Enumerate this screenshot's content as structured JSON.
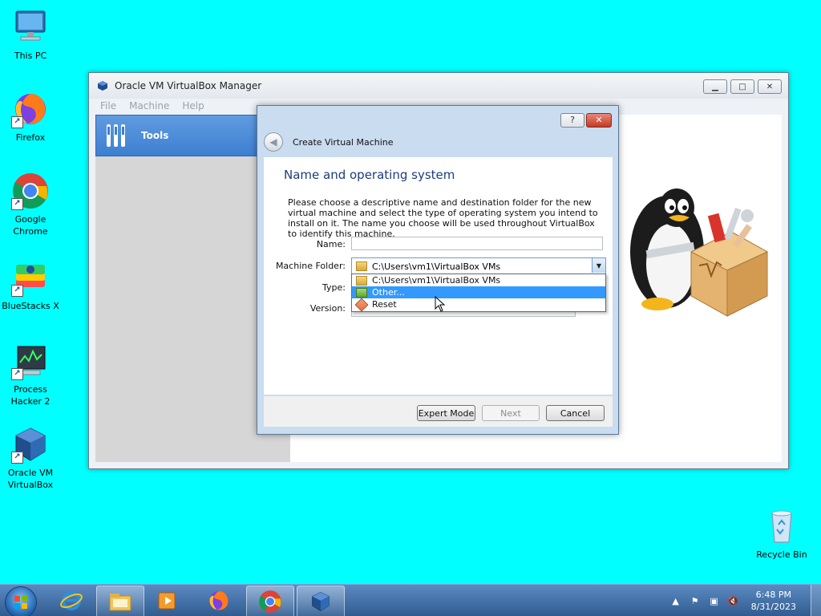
{
  "desktop": {
    "icons": [
      {
        "label": "This PC",
        "icon": "computer-icon"
      },
      {
        "label": "Firefox",
        "icon": "firefox-icon"
      },
      {
        "label": "Google Chrome",
        "icon": "chrome-icon"
      },
      {
        "label": "BlueStacks X",
        "icon": "bluestacks-icon"
      },
      {
        "label": "Process Hacker 2",
        "icon": "process-hacker-icon"
      },
      {
        "label": "Oracle VM VirtualBox",
        "icon": "virtualbox-icon"
      },
      {
        "label": "Recycle Bin",
        "icon": "recycle-bin-icon"
      }
    ]
  },
  "vbox": {
    "title": "Oracle VM VirtualBox Manager",
    "menu": [
      "File",
      "Machine",
      "Help"
    ],
    "tools_label": "Tools"
  },
  "dialog": {
    "title": "Create Virtual Machine",
    "heading": "Name and operating system",
    "description": "Please choose a descriptive name and destination folder for the new virtual machine and select the type of operating system you intend to install on it. The name you choose will be used throughout VirtualBox to identify this machine.",
    "name_label": "Name:",
    "name_value": "",
    "folder_label": "Machine Folder:",
    "folder_value": "C:\\Users\\vm1\\VirtualBox VMs",
    "type_label": "Type:",
    "version_label": "Version:",
    "dropdown": [
      {
        "label": "C:\\Users\\vm1\\VirtualBox VMs",
        "selected": false
      },
      {
        "label": "Other...",
        "selected": true
      },
      {
        "label": "Reset",
        "selected": false
      }
    ],
    "expert_label": "Expert Mode",
    "next_label": "Next",
    "cancel_label": "Cancel",
    "help_glyph": "?"
  },
  "taskbar": {
    "items": [
      "start",
      "internet-explorer",
      "file-explorer",
      "media-player",
      "firefox",
      "chrome",
      "virtualbox"
    ],
    "time": "6:48 PM",
    "date": "8/31/2023"
  },
  "colors": {
    "desktop": "#00FFFF",
    "selection": "#3399ff",
    "heading": "#1d3d7a"
  }
}
